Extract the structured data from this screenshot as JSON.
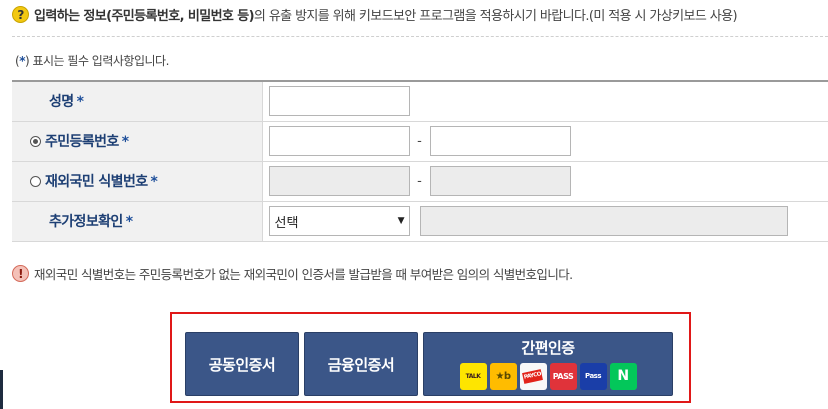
{
  "notice": {
    "icon": "question-icon",
    "bold_text": "입력하는 정보(주민등록번호, 비밀번호 등)",
    "text": "의 유출 방지를 위해 키보드보안 프로그램을 적용하시기 바랍니다.(미 적용 시 가상키보드 사용)"
  },
  "required_note": {
    "open": "(",
    "star": "*",
    "text": ") 표시는 필수 입력사항입니다."
  },
  "form": {
    "name_label": "성명",
    "rrn_label": "주민등록번호",
    "foreigner_label": "재외국민 식별번호",
    "extra_label": "추가정보확인",
    "star": "*",
    "dash": "-",
    "select_value": "선택",
    "selected_option": "주민등록번호"
  },
  "warning": {
    "icon": "exclamation-icon",
    "text": "재외국민 식별번호는 주민등록번호가 없는 재외국민이 인증서를 발급받을 때 부여받은 임의의 식별번호입니다."
  },
  "cert_buttons": {
    "gongdong": "공동인증서",
    "geumyung": "금융인증서",
    "ganpyeon": "간편인증",
    "logos": {
      "kakao": "TALK",
      "kb": "★b",
      "payco": "PAYCO",
      "pass": "PASS",
      "samsung": "Pass",
      "naver": "N"
    }
  },
  "colors": {
    "label_text": "#1d3f74",
    "button_bg": "#3b5688",
    "highlight_border": "#e01818"
  }
}
